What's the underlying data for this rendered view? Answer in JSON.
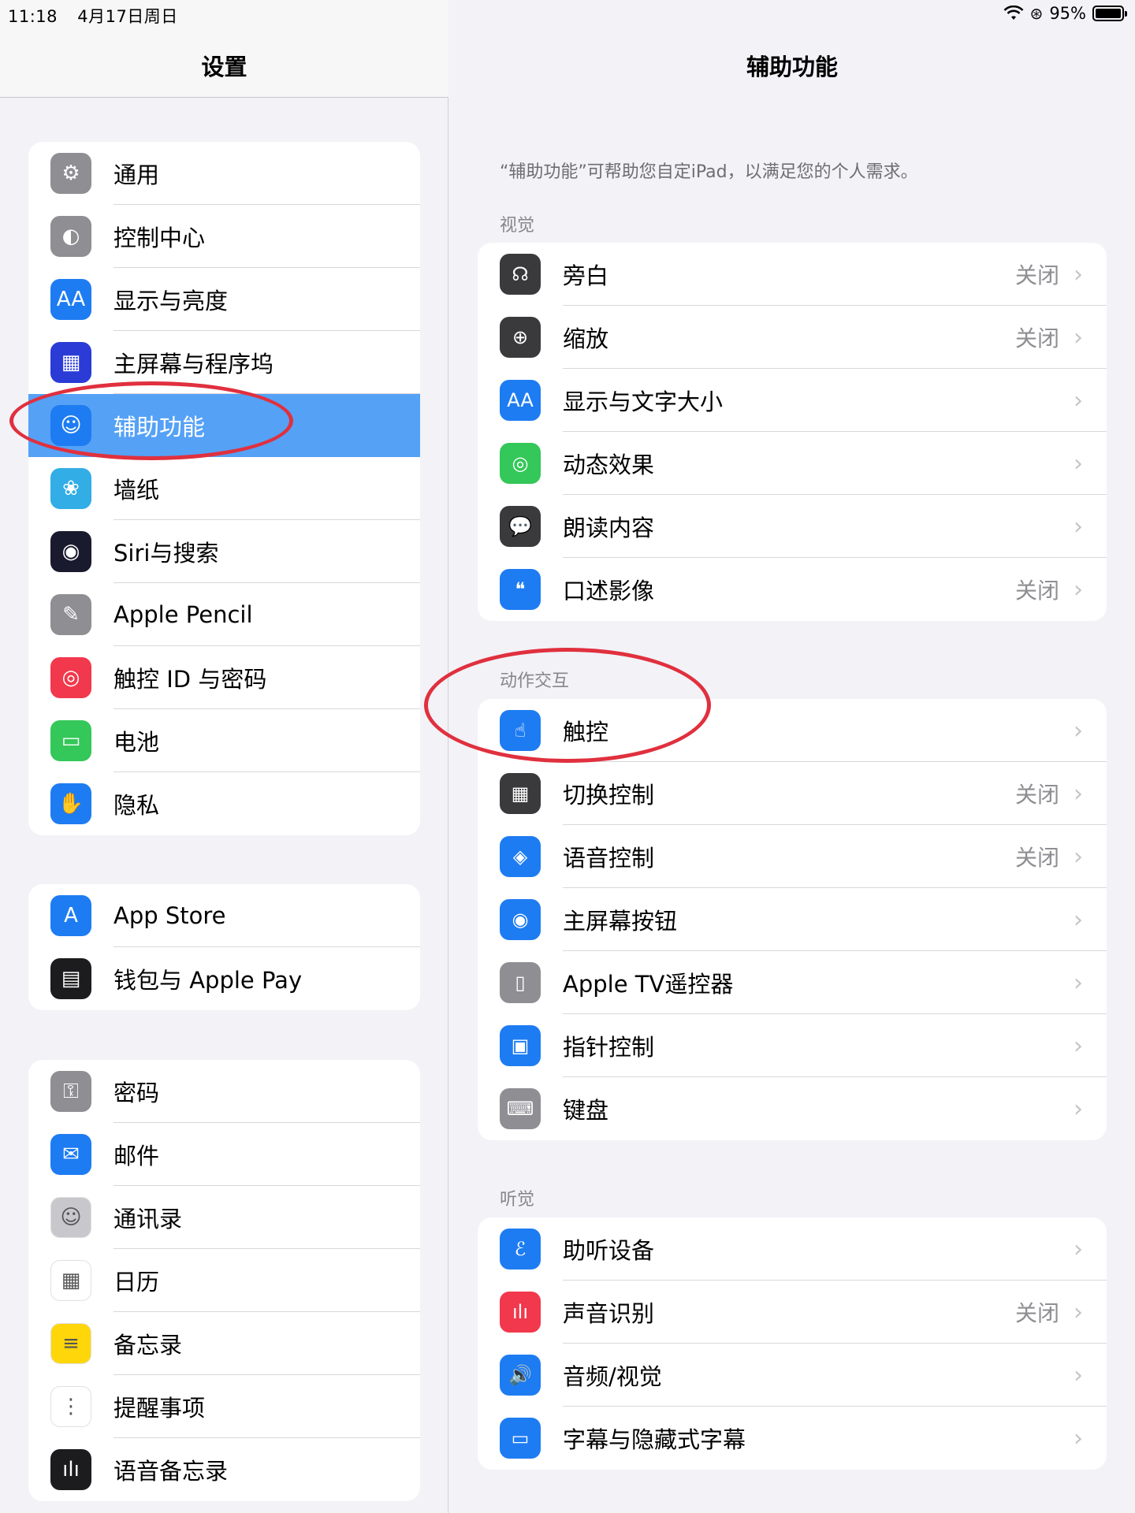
{
  "status": {
    "time": "11:18",
    "date": "4月17日周日",
    "battery": "95%"
  },
  "left": {
    "title": "设置",
    "groups": [
      [
        {
          "label": "通用",
          "icon": "gear-icon",
          "color": "#8e8e93",
          "glyph": "⚙"
        },
        {
          "label": "控制中心",
          "icon": "toggle-icon",
          "color": "#8e8e93",
          "glyph": "◐"
        },
        {
          "label": "显示与亮度",
          "icon": "text-size-icon",
          "color": "#1e7cf2",
          "glyph": "AA"
        },
        {
          "label": "主屏幕与程序坞",
          "icon": "home-grid-icon",
          "color": "#2a3bd6",
          "glyph": "▦"
        },
        {
          "label": "辅助功能",
          "icon": "accessibility-icon",
          "color": "#1e7cf2",
          "glyph": "☺",
          "selected": true
        },
        {
          "label": "墙纸",
          "icon": "flower-icon",
          "color": "#32ade6",
          "glyph": "❀"
        },
        {
          "label": "Siri与搜索",
          "icon": "siri-icon",
          "color": "#1a1a2e",
          "glyph": "◉"
        },
        {
          "label": "Apple Pencil",
          "icon": "pencil-icon",
          "color": "#8e8e93",
          "glyph": "✎"
        },
        {
          "label": "触控 ID 与密码",
          "icon": "fingerprint-icon",
          "color": "#f2384c",
          "glyph": "◎"
        },
        {
          "label": "电池",
          "icon": "battery-icon",
          "color": "#34c759",
          "glyph": "▭"
        },
        {
          "label": "隐私",
          "icon": "hand-icon",
          "color": "#1e7cf2",
          "glyph": "✋"
        }
      ],
      [
        {
          "label": "App Store",
          "icon": "app-store-icon",
          "color": "#1e7cf2",
          "glyph": "A"
        },
        {
          "label": "钱包与 Apple Pay",
          "icon": "wallet-icon",
          "color": "#1c1c1e",
          "glyph": "▤"
        }
      ],
      [
        {
          "label": "密码",
          "icon": "key-icon",
          "color": "#8e8e93",
          "glyph": "⚿"
        },
        {
          "label": "邮件",
          "icon": "mail-icon",
          "color": "#1e7cf2",
          "glyph": "✉"
        },
        {
          "label": "通讯录",
          "icon": "contacts-icon",
          "color": "#c7c7cc",
          "glyph": "☺"
        },
        {
          "label": "日历",
          "icon": "calendar-icon",
          "color": "#ffffff",
          "glyph": "▦"
        },
        {
          "label": "备忘录",
          "icon": "notes-icon",
          "color": "#ffd60a",
          "glyph": "≡"
        },
        {
          "label": "提醒事项",
          "icon": "reminders-icon",
          "color": "#ffffff",
          "glyph": "⋮"
        },
        {
          "label": "语音备忘录",
          "icon": "voice-memo-icon",
          "color": "#1c1c1e",
          "glyph": "ılı"
        }
      ]
    ]
  },
  "right": {
    "title": "辅助功能",
    "description": "“辅助功能”可帮助您自定iPad，以满足您的个人需求。",
    "sections": [
      {
        "header": "视觉",
        "rows": [
          {
            "label": "旁白",
            "value": "关闭",
            "icon": "voiceover-icon",
            "color": "#3a3a3c",
            "glyph": "☊"
          },
          {
            "label": "缩放",
            "value": "关闭",
            "icon": "zoom-icon",
            "color": "#3a3a3c",
            "glyph": "⊕"
          },
          {
            "label": "显示与文字大小",
            "value": "",
            "icon": "text-size-icon",
            "color": "#1e7cf2",
            "glyph": "AA"
          },
          {
            "label": "动态效果",
            "value": "",
            "icon": "motion-icon",
            "color": "#34c759",
            "glyph": "◎"
          },
          {
            "label": "朗读内容",
            "value": "",
            "icon": "speech-icon",
            "color": "#3a3a3c",
            "glyph": "💬"
          },
          {
            "label": "口述影像",
            "value": "关闭",
            "icon": "audio-description-icon",
            "color": "#1e7cf2",
            "glyph": "❝"
          }
        ]
      },
      {
        "header": "动作交互",
        "rows": [
          {
            "label": "触控",
            "value": "",
            "icon": "touch-icon",
            "color": "#1e7cf2",
            "glyph": "☝"
          },
          {
            "label": "切换控制",
            "value": "关闭",
            "icon": "switch-control-icon",
            "color": "#3a3a3c",
            "glyph": "▦"
          },
          {
            "label": "语音控制",
            "value": "关闭",
            "icon": "voice-control-icon",
            "color": "#1e7cf2",
            "glyph": "◈"
          },
          {
            "label": "主屏幕按钮",
            "value": "",
            "icon": "home-button-icon",
            "color": "#1e7cf2",
            "glyph": "◉"
          },
          {
            "label": "Apple TV遥控器",
            "value": "",
            "icon": "remote-icon",
            "color": "#8e8e93",
            "glyph": "▯"
          },
          {
            "label": "指针控制",
            "value": "",
            "icon": "pointer-icon",
            "color": "#1e7cf2",
            "glyph": "▣"
          },
          {
            "label": "键盘",
            "value": "",
            "icon": "keyboard-icon",
            "color": "#8e8e93",
            "glyph": "⌨"
          }
        ]
      },
      {
        "header": "听觉",
        "rows": [
          {
            "label": "助听设备",
            "value": "",
            "icon": "ear-icon",
            "color": "#1e7cf2",
            "glyph": "ℰ"
          },
          {
            "label": "声音识别",
            "value": "关闭",
            "icon": "sound-recognition-icon",
            "color": "#f2384c",
            "glyph": "ılı"
          },
          {
            "label": "音频/视觉",
            "value": "",
            "icon": "audio-visual-icon",
            "color": "#1e7cf2",
            "glyph": "🔊"
          },
          {
            "label": "字幕与隐藏式字幕",
            "value": "",
            "icon": "captions-icon",
            "color": "#1e7cf2",
            "glyph": "▭"
          }
        ]
      }
    ]
  }
}
